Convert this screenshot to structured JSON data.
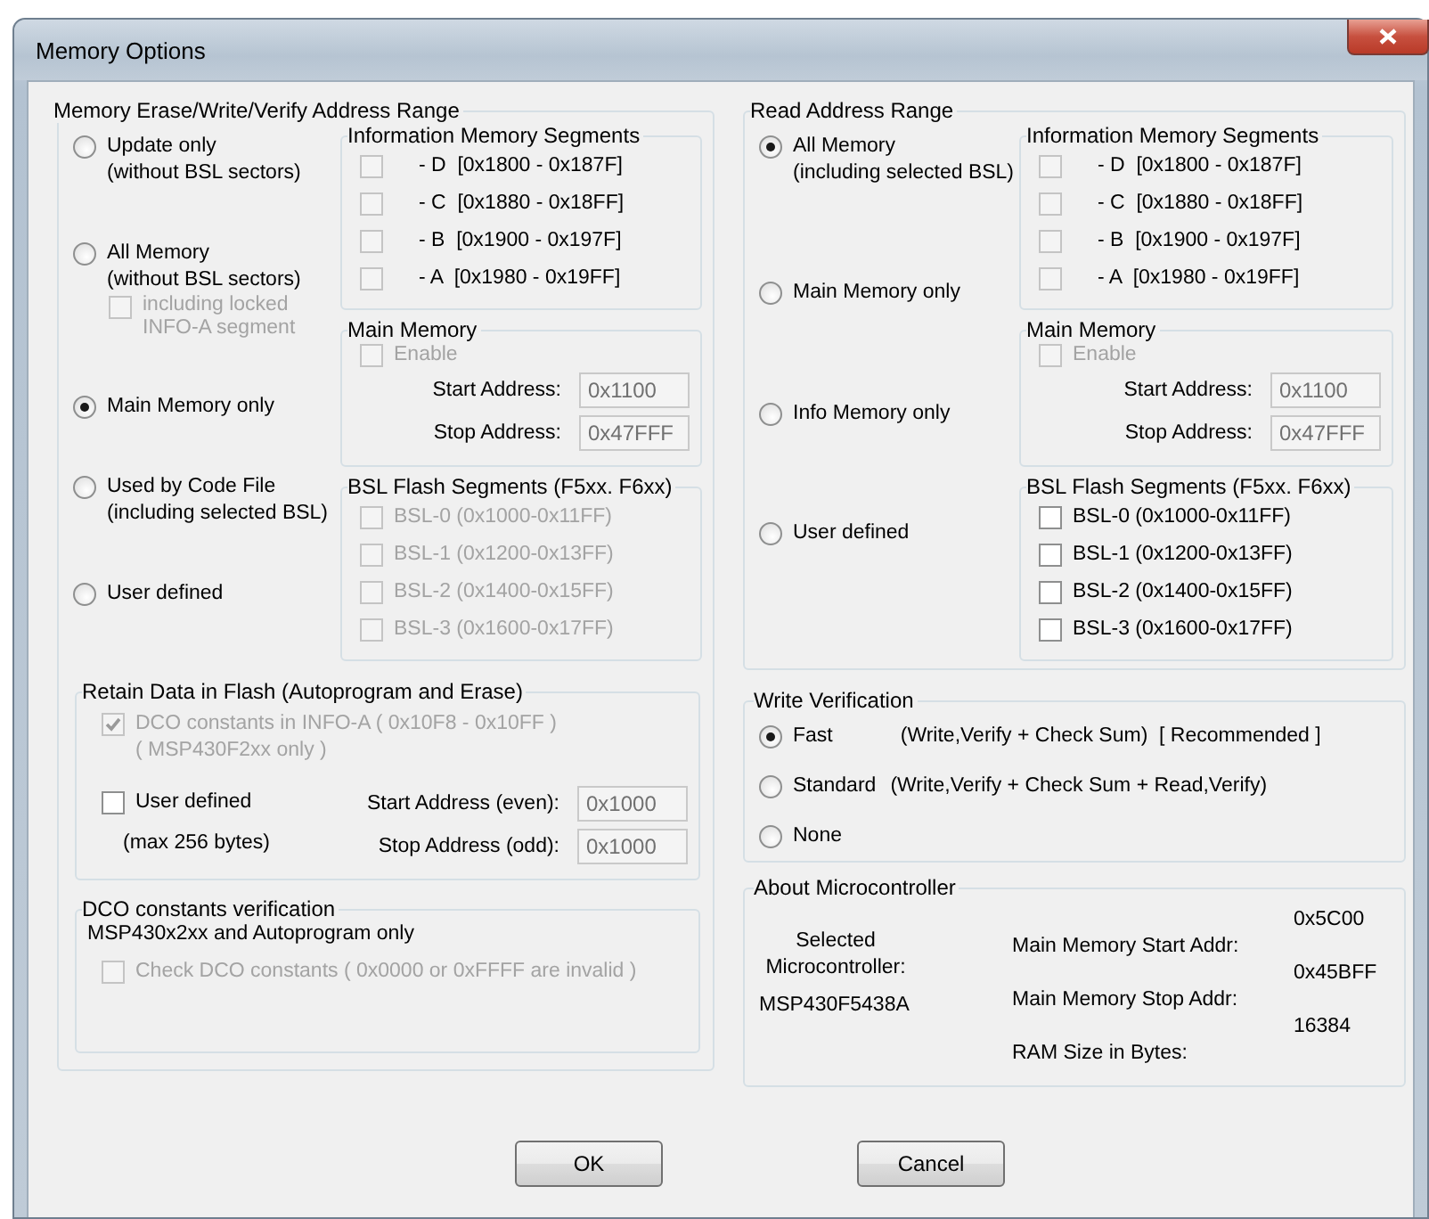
{
  "window": {
    "title": "Memory Options"
  },
  "erase_range": {
    "title": "Memory Erase/Write/Verify Address Range",
    "options": [
      {
        "lines": [
          "Update only",
          "(without BSL sectors)"
        ],
        "selected": false
      },
      {
        "lines": [
          "All Memory",
          "(without BSL sectors)"
        ],
        "selected": false,
        "sub_option": {
          "lines": [
            "including locked",
            "INFO-A segment"
          ],
          "checked": false,
          "disabled": true
        }
      },
      {
        "lines": [
          "Main Memory only"
        ],
        "selected": true
      },
      {
        "lines": [
          "Used by Code File",
          "(including selected BSL)"
        ],
        "selected": false
      },
      {
        "lines": [
          "User defined"
        ],
        "selected": false
      }
    ],
    "info_segments": {
      "title": "Information Memory Segments",
      "items": [
        {
          "label": "- D  [0x1800 - 0x187F]",
          "checked": false,
          "disabled": true
        },
        {
          "label": "- C  [0x1880 - 0x18FF]",
          "checked": false,
          "disabled": true
        },
        {
          "label": "- B  [0x1900 - 0x197F]",
          "checked": false,
          "disabled": true
        },
        {
          "label": "- A  [0x1980 - 0x19FF]",
          "checked": false,
          "disabled": true
        }
      ]
    },
    "main_memory": {
      "title": "Main Memory",
      "enable": {
        "label": "Enable",
        "checked": false,
        "disabled": true
      },
      "fields": [
        {
          "label": "Start Address:",
          "value": "0x1100",
          "disabled": true
        },
        {
          "label": "Stop Address:",
          "value": "0x47FFF",
          "disabled": true
        }
      ]
    },
    "bsl_segments": {
      "title": "BSL Flash Segments (F5xx. F6xx)",
      "items": [
        {
          "label": "BSL-0 (0x1000-0x11FF)",
          "checked": false,
          "disabled": true
        },
        {
          "label": "BSL-1 (0x1200-0x13FF)",
          "checked": false,
          "disabled": true
        },
        {
          "label": "BSL-2 (0x1400-0x15FF)",
          "checked": false,
          "disabled": true
        },
        {
          "label": "BSL-3 (0x1600-0x17FF)",
          "checked": false,
          "disabled": true
        }
      ]
    }
  },
  "retain_data": {
    "title": "Retain Data in Flash   (Autoprogram and Erase)",
    "dco": {
      "lines": [
        "DCO constants in INFO-A ( 0x10F8 - 0x10FF )",
        "( MSP430F2xx only )"
      ],
      "checked": true,
      "disabled": true
    },
    "user_defined": {
      "label": "User defined",
      "checked": false,
      "disabled": false
    },
    "note": "(max 256 bytes)",
    "fields": [
      {
        "label": "Start Address (even):",
        "value": "0x1000",
        "disabled": true
      },
      {
        "label": "Stop Address (odd):",
        "value": "0x1000",
        "disabled": true
      }
    ]
  },
  "dco_verification": {
    "title": "DCO constants verification",
    "note": "MSP430x2xx and Autoprogram only",
    "check": {
      "label": "Check DCO constants ( 0x0000 or 0xFFFF are invalid )",
      "checked": false,
      "disabled": true
    }
  },
  "read_range": {
    "title": "Read Address Range",
    "options": [
      {
        "lines": [
          "All Memory",
          "(including selected BSL)"
        ],
        "selected": true
      },
      {
        "lines": [
          "Main Memory only"
        ],
        "selected": false
      },
      {
        "lines": [
          "Info Memory only"
        ],
        "selected": false
      },
      {
        "lines": [
          "User defined"
        ],
        "selected": false
      }
    ],
    "info_segments": {
      "title": "Information Memory Segments",
      "items": [
        {
          "label": "- D  [0x1800 - 0x187F]",
          "checked": false,
          "disabled": true
        },
        {
          "label": "- C  [0x1880 - 0x18FF]",
          "checked": false,
          "disabled": true
        },
        {
          "label": "- B  [0x1900 - 0x197F]",
          "checked": false,
          "disabled": true
        },
        {
          "label": "- A  [0x1980 - 0x19FF]",
          "checked": false,
          "disabled": true
        }
      ]
    },
    "main_memory": {
      "title": "Main Memory",
      "enable": {
        "label": "Enable",
        "checked": false,
        "disabled": true
      },
      "fields": [
        {
          "label": "Start Address:",
          "value": "0x1100",
          "disabled": true
        },
        {
          "label": "Stop Address:",
          "value": "0x47FFF",
          "disabled": true
        }
      ]
    },
    "bsl_segments": {
      "title": "BSL Flash Segments (F5xx. F6xx)",
      "items": [
        {
          "label": "BSL-0 (0x1000-0x11FF)",
          "checked": false,
          "disabled": false
        },
        {
          "label": "BSL-1 (0x1200-0x13FF)",
          "checked": false,
          "disabled": false
        },
        {
          "label": "BSL-2 (0x1400-0x15FF)",
          "checked": false,
          "disabled": false
        },
        {
          "label": "BSL-3 (0x1600-0x17FF)",
          "checked": false,
          "disabled": false
        }
      ]
    }
  },
  "write_verification": {
    "title": "Write Verification",
    "options": [
      {
        "label": "Fast",
        "detail": "(Write,Verify + Check Sum)  [ Recommended ]",
        "selected": true
      },
      {
        "label": "Standard",
        "detail": "(Write,Verify + Check Sum + Read,Verify)",
        "selected": false
      },
      {
        "label": "None",
        "selected": false
      }
    ]
  },
  "about": {
    "title": "About Microcontroller",
    "selected_label": "Selected Microcontroller:",
    "device": "MSP430F5438A",
    "rows": [
      {
        "label": "Main Memory Start Addr:",
        "value": "0x5C00"
      },
      {
        "label": "Main Memory Stop Addr:",
        "value": "0x45BFF"
      },
      {
        "label": "RAM Size in Bytes:",
        "value": "16384"
      }
    ]
  },
  "buttons": [
    {
      "label": "OK"
    },
    {
      "label": "Cancel"
    }
  ]
}
